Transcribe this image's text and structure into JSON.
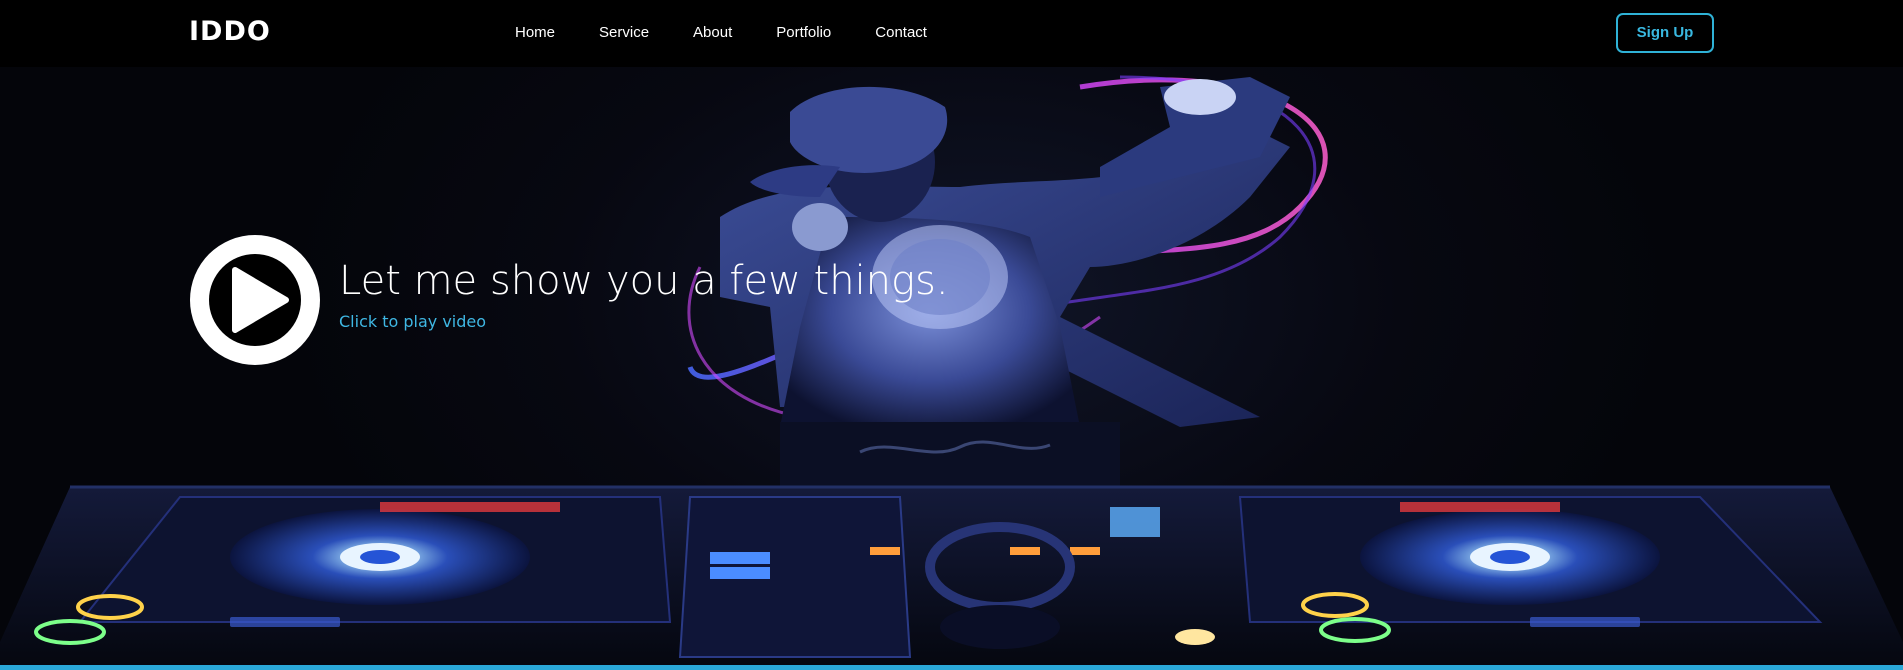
{
  "nav": {
    "logo": "IDDO",
    "links": [
      "Home",
      "Service",
      "About",
      "Portfolio",
      "Contact"
    ],
    "signup_label": "Sign Up"
  },
  "hero": {
    "title": "Let me show you a few things.",
    "subtitle": "Click to play video",
    "play_icon": "play-icon"
  },
  "colors": {
    "accent": "#39b8e0",
    "background": "#000000",
    "text": "#ffffff"
  }
}
